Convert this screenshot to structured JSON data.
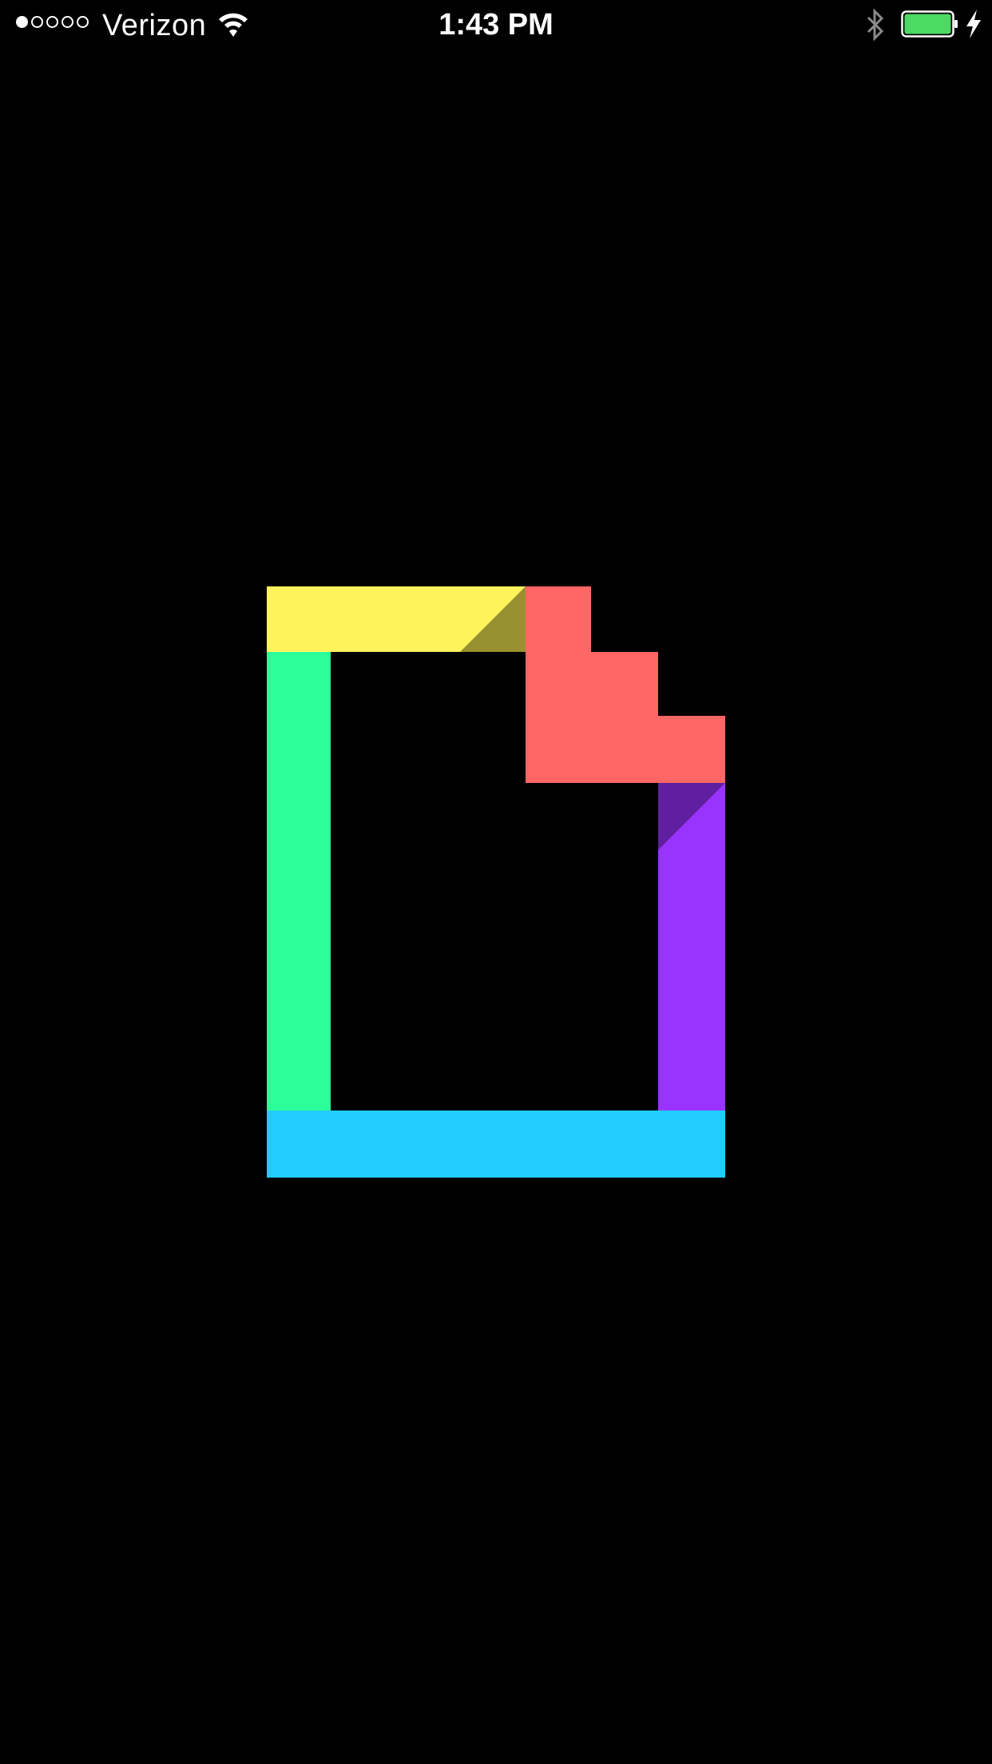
{
  "status_bar": {
    "carrier": "Verizon",
    "time": "1:43 PM",
    "signal_bars_filled": 1,
    "signal_bars_total": 5,
    "battery_level": 1.0,
    "battery_color": "#4cd964",
    "charging": true,
    "icons": [
      "wifi-icon",
      "bluetooth-icon",
      "battery-icon",
      "charging-bolt-icon"
    ]
  },
  "logo": {
    "icon": "giphy-logo-icon",
    "colors": {
      "yellow": "#fff35c",
      "yellow_shade": "#999131",
      "coral": "#ff6666",
      "green": "#00ff99",
      "green_display": "#2bff99",
      "purple": "#9933ff",
      "purple_shade": "#5f1f9e",
      "cyan": "#00ccff",
      "cyan_display": "#22ccff"
    }
  }
}
